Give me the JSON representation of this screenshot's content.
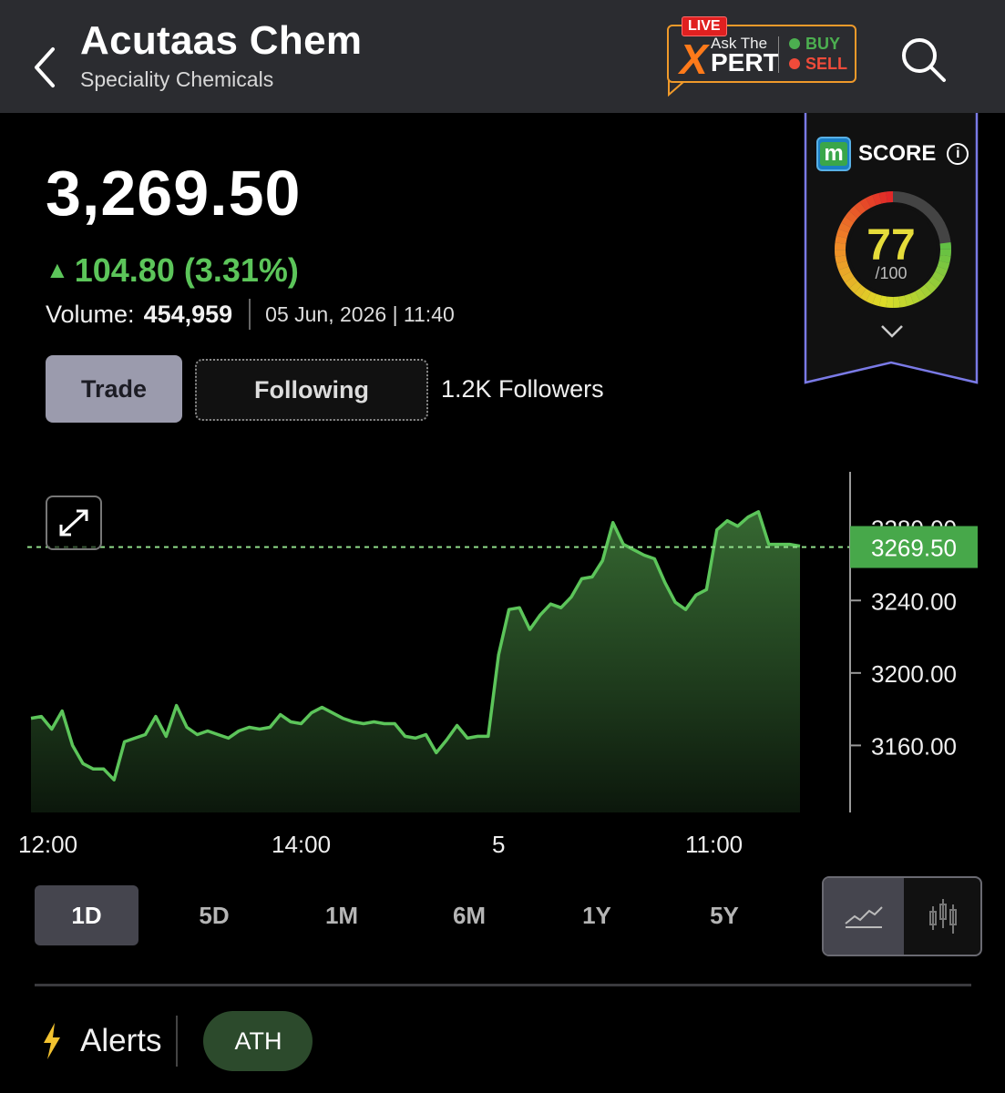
{
  "header": {
    "title": "Acutaas Chem",
    "subtitle": "Speciality Chemicals",
    "promo": {
      "live": "LIVE",
      "ask": "Ask The",
      "x": "X",
      "pert": "PERT",
      "buy": "BUY",
      "sell": "SELL"
    }
  },
  "quote": {
    "price": "3,269.50",
    "change": "104.80 (3.31%)",
    "change_color": "#5cc55a",
    "volume_label": "Volume:",
    "volume_value": "454,959",
    "datetime": "05 Jun, 2026 | 11:40"
  },
  "actions": {
    "trade": "Trade",
    "following": "Following",
    "followers": "1.2K Followers"
  },
  "score": {
    "label": "SCORE",
    "value": "77",
    "max": "/100",
    "fraction": 0.77
  },
  "chart_data": {
    "type": "area",
    "title": "",
    "xlabel": "",
    "ylabel": "",
    "x_ticks": [
      "12:00",
      "14:00",
      "5",
      "11:00"
    ],
    "y_ticks": [
      "3280.00",
      "3240.00",
      "3200.00",
      "3160.00"
    ],
    "current_price_label": "3269.50",
    "current_price": 3269.5,
    "ylim": [
      3123,
      3310
    ],
    "grid": false,
    "color": "#5cc55a",
    "values": [
      3175,
      3176,
      3169,
      3179,
      3160,
      3150,
      3147,
      3147,
      3141,
      3162,
      3164,
      3166,
      3176,
      3165,
      3182,
      3170,
      3166,
      3168,
      3166,
      3164,
      3168,
      3170,
      3169,
      3170,
      3177,
      3173,
      3172,
      3178,
      3181,
      3178,
      3175,
      3173,
      3172,
      3173,
      3172,
      3172,
      3165,
      3164,
      3166,
      3156,
      3163,
      3171,
      3164,
      3165,
      3165,
      3210,
      3235,
      3236,
      3224,
      3232,
      3238,
      3236,
      3242,
      3252,
      3253,
      3262,
      3283,
      3271,
      3268,
      3265,
      3263,
      3250,
      3239,
      3235,
      3243,
      3246,
      3279,
      3284,
      3281,
      3286,
      3289,
      3271,
      3271,
      3271,
      3270
    ]
  },
  "ranges": {
    "items": [
      "1D",
      "5D",
      "1M",
      "6M",
      "1Y",
      "5Y"
    ],
    "active": "1D"
  },
  "alerts": {
    "label": "Alerts",
    "tag": "ATH"
  }
}
